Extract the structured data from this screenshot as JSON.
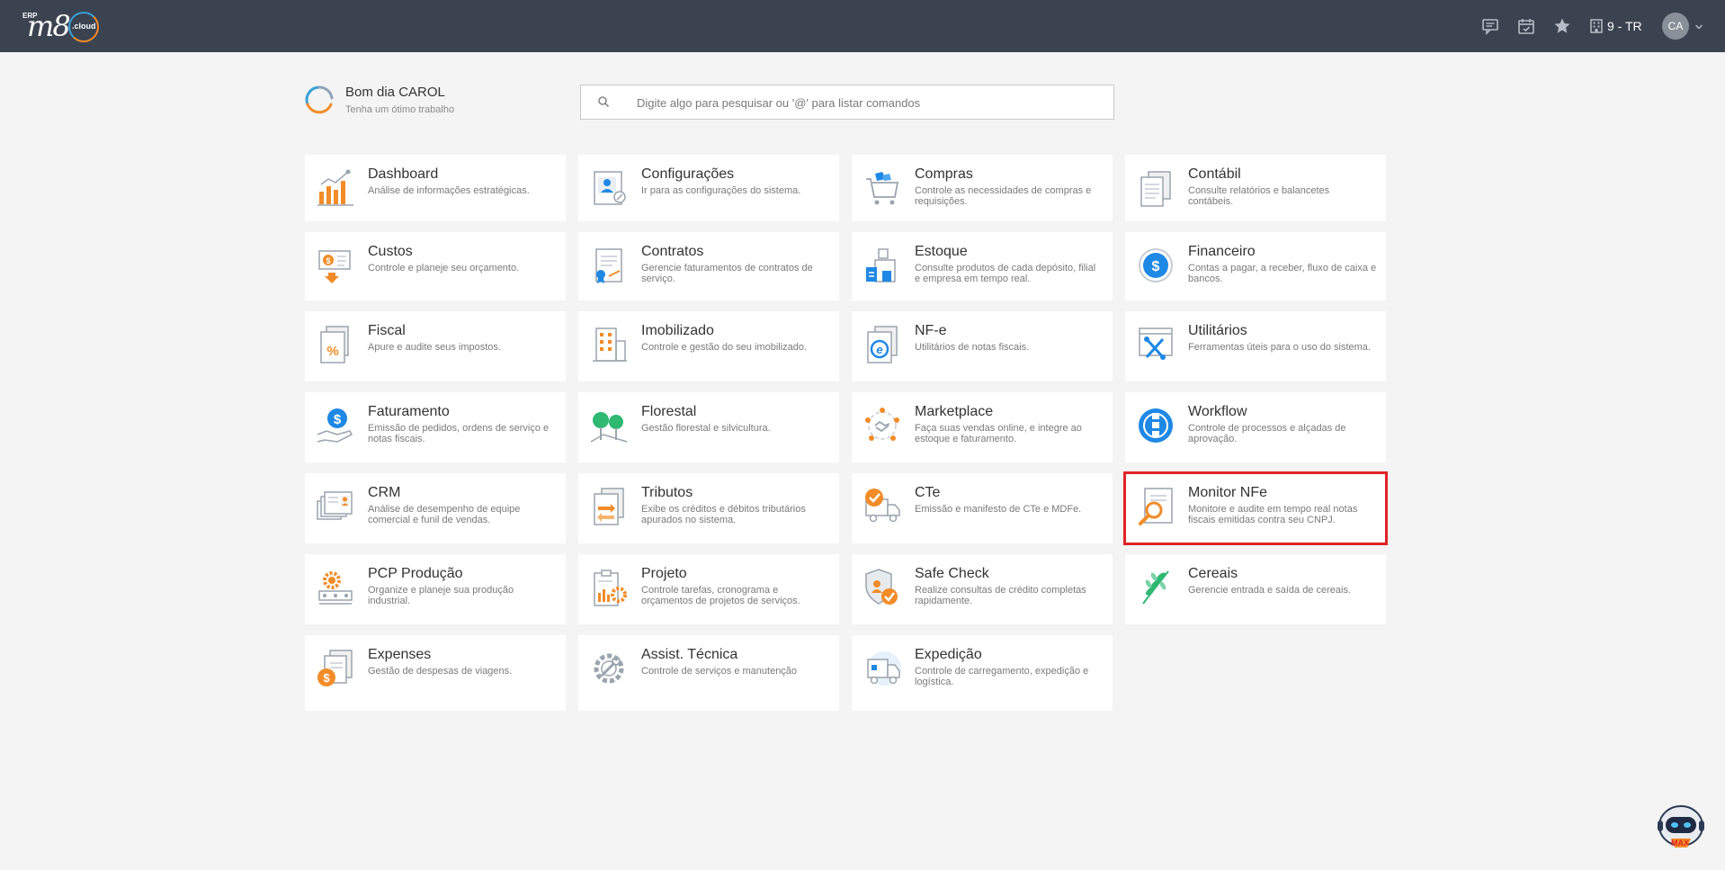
{
  "header": {
    "logo_erp": "ERP",
    "logo_m8": "m8",
    "logo_cloud": ".cloud",
    "company_label": "9 - TR",
    "avatar_initials": "CA",
    "icons": [
      "chat-icon",
      "calendar-icon",
      "star-icon",
      "building-icon",
      "chevron-down-icon"
    ]
  },
  "greeting": {
    "title": "Bom dia CAROL",
    "subtitle": "Tenha um ótimo trabalho"
  },
  "search": {
    "placeholder": "Digite algo para pesquisar ou '@' para listar comandos"
  },
  "modules": [
    {
      "title": "Dashboard",
      "desc": "Análise de informações estratégicas."
    },
    {
      "title": "Configurações",
      "desc": "Ir para as configurações do sistema."
    },
    {
      "title": "Compras",
      "desc": "Controle as necessidades de compras e requisições."
    },
    {
      "title": "Contábil",
      "desc": "Consulte relatórios e balancetes contábeis."
    },
    {
      "title": "Custos",
      "desc": "Controle e planeje seu orçamento."
    },
    {
      "title": "Contratos",
      "desc": "Gerencie faturamentos de contratos de serviço."
    },
    {
      "title": "Estoque",
      "desc": "Consulte produtos de cada depósito, filial e empresa em tempo real."
    },
    {
      "title": "Financeiro",
      "desc": "Contas a pagar, a receber, fluxo de caixa e bancos."
    },
    {
      "title": "Fiscal",
      "desc": "Apure e audite seus impostos."
    },
    {
      "title": "Imobilizado",
      "desc": "Controle e gestão do seu imobilizado."
    },
    {
      "title": "NF-e",
      "desc": "Utilitários de notas fiscais."
    },
    {
      "title": "Utilitários",
      "desc": "Ferramentas úteis para o uso do sistema."
    },
    {
      "title": "Faturamento",
      "desc": "Emissão de pedidos, ordens de serviço e notas fiscais."
    },
    {
      "title": "Florestal",
      "desc": "Gestão florestal e silvicultura."
    },
    {
      "title": "Marketplace",
      "desc": "Faça suas vendas online, e integre ao estoque e faturamento."
    },
    {
      "title": "Workflow",
      "desc": "Controle de processos e alçadas de aprovação."
    },
    {
      "title": "CRM",
      "desc": "Análise de desempenho de equipe comercial e funil de vendas."
    },
    {
      "title": "Tributos",
      "desc": "Exibe os créditos e débitos tributários apurados no sistema."
    },
    {
      "title": "CTe",
      "desc": "Emissão e manifesto de CTe e MDFe."
    },
    {
      "title": "Monitor NFe",
      "desc": "Monitore e audite em tempo real notas fiscais emitidas contra seu CNPJ."
    },
    {
      "title": "PCP Produção",
      "desc": "Organize e planeje sua produção industrial."
    },
    {
      "title": "Projeto",
      "desc": "Controle tarefas, cronograma e orçamentos de projetos de serviços."
    },
    {
      "title": "Safe Check",
      "desc": "Realize consultas de crédito completas rapidamente."
    },
    {
      "title": "Cereais",
      "desc": "Gerencie entrada e saída de cereais."
    },
    {
      "title": "Expenses",
      "desc": "Gestão de despesas de viagens."
    },
    {
      "title": "Assist. Técnica",
      "desc": "Controle de serviços e manutenção"
    },
    {
      "title": "Expedição",
      "desc": "Controle de carregamento, expedição e logística."
    }
  ],
  "assistant_label": "MAX",
  "colors": {
    "topbar": "#3b4350",
    "accent_orange": "#f28c28",
    "accent_blue": "#1e88e5",
    "highlight": "#e02424"
  }
}
